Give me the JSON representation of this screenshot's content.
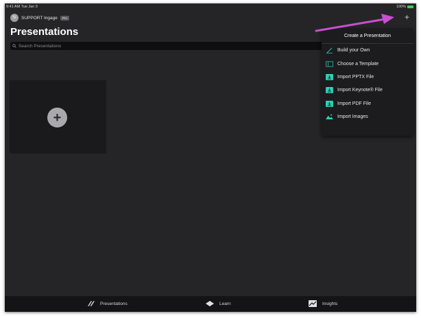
{
  "status_bar": {
    "time": "9:41 AM  Tue Jan 9",
    "battery": "100%"
  },
  "account": {
    "initials": "SI",
    "name": "SUPPORT Ingage",
    "badge": "Pro"
  },
  "header": {
    "title": "Presentations"
  },
  "search": {
    "placeholder": "Search Presentations"
  },
  "toolbar": {
    "add_symbol": "+"
  },
  "new_card": {
    "symbol": "+"
  },
  "menu": {
    "title": "Create a Presentation",
    "items": [
      {
        "label": "Build your Own",
        "icon": "pencil-icon"
      },
      {
        "label": "Choose a Template",
        "icon": "template-icon"
      },
      {
        "label": "Import PPTX File",
        "icon": "import-pptx-icon"
      },
      {
        "label": "Import Keynote® File",
        "icon": "import-keynote-icon"
      },
      {
        "label": "Import PDF File",
        "icon": "import-pdf-icon"
      },
      {
        "label": "Import Images",
        "icon": "image-icon"
      }
    ]
  },
  "tabs": [
    {
      "label": "Presentations",
      "icon": "presentations-icon"
    },
    {
      "label": "Learn",
      "icon": "learn-icon"
    },
    {
      "label": "Insights",
      "icon": "insights-icon"
    }
  ],
  "colors": {
    "accent": "#2ed3b7",
    "annotation_arrow": "#c94fd0",
    "background": "#252528"
  }
}
